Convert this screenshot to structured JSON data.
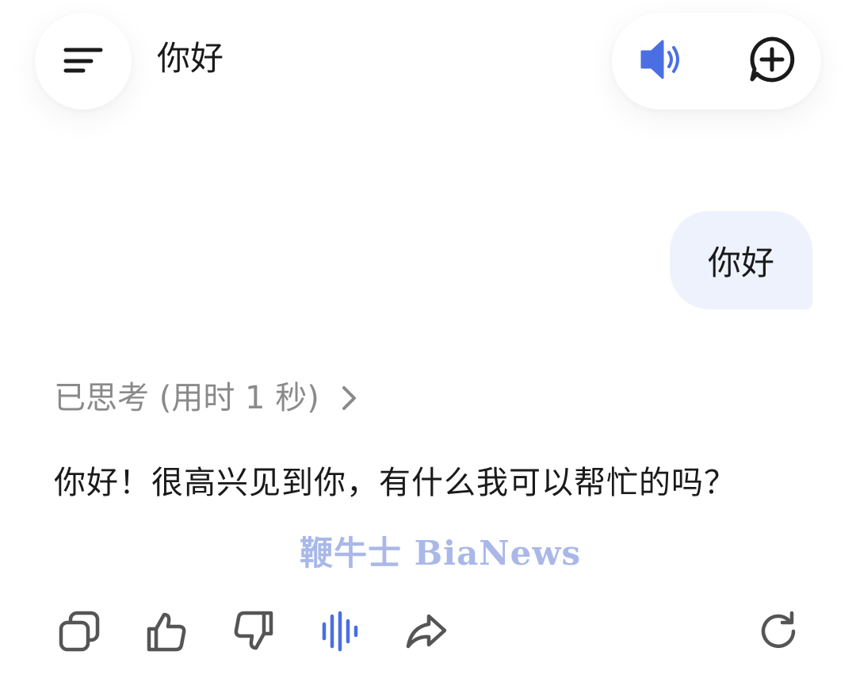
{
  "header": {
    "title": "你好",
    "menu_icon": "menu-lines-icon",
    "speaker_icon": "speaker-icon",
    "new_chat_icon": "new-chat-icon"
  },
  "conversation": {
    "user_message": "你好",
    "thinking_status": "已思考 (用时 1 秒)",
    "assistant_reply": "你好！很高兴见到你，有什么我可以帮忙的吗？"
  },
  "watermark": {
    "text": "鞭牛士 BiaNews"
  },
  "action_bar": {
    "icons": [
      "copy-icon",
      "thumbs-up-icon",
      "thumbs-down-icon",
      "voice-wave-icon",
      "share-icon",
      "regenerate-icon"
    ]
  },
  "colors": {
    "accent": "#4a6fe3",
    "user_bubble": "#eef2fd",
    "muted_text": "#8a8a8a",
    "watermark": "#a9b8e8"
  }
}
